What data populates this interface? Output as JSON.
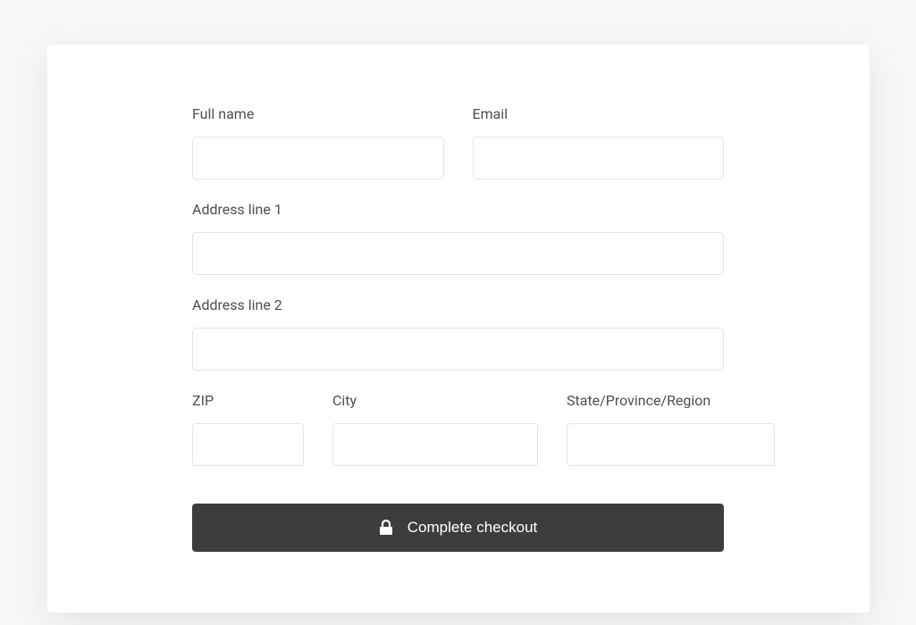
{
  "form": {
    "full_name": {
      "label": "Full name",
      "value": ""
    },
    "email": {
      "label": "Email",
      "value": ""
    },
    "address1": {
      "label": "Address line 1",
      "value": ""
    },
    "address2": {
      "label": "Address line 2",
      "value": ""
    },
    "zip": {
      "label": "ZIP",
      "value": ""
    },
    "city": {
      "label": "City",
      "value": ""
    },
    "region": {
      "label": "State/Province/Region",
      "value": ""
    },
    "submit_label": "Complete checkout"
  }
}
